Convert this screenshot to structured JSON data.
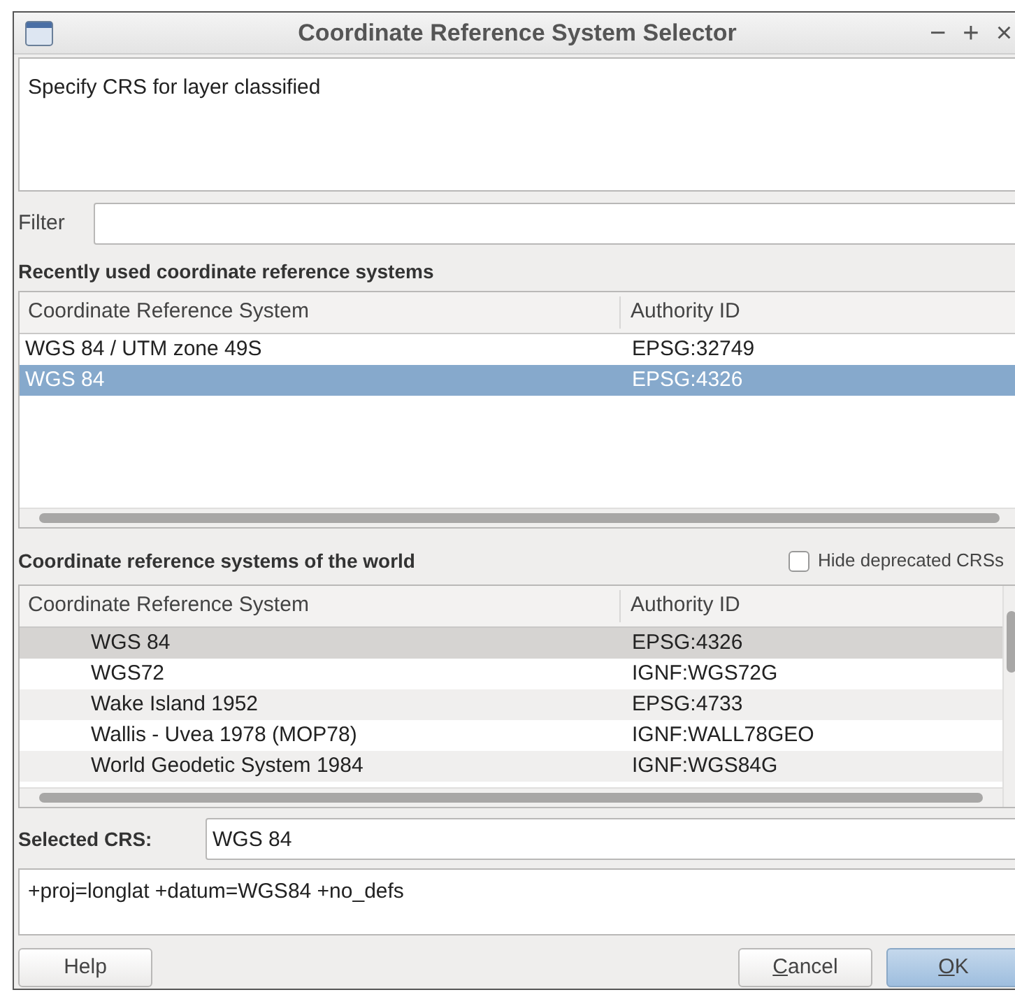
{
  "window": {
    "title": "Coordinate Reference System Selector",
    "controls": [
      "−",
      "+",
      "×"
    ]
  },
  "description": "Specify CRS for layer classified",
  "filter": {
    "label": "Filter"
  },
  "recent": {
    "heading": "Recently used coordinate reference systems",
    "columns": [
      "Coordinate Reference System",
      "Authority ID"
    ],
    "rows": [
      {
        "name": "WGS 84 / UTM zone 49S",
        "authority_id": "EPSG:32749",
        "selected": false
      },
      {
        "name": "WGS 84",
        "authority_id": "EPSG:4326",
        "selected": true
      }
    ]
  },
  "world": {
    "heading": "Coordinate reference systems of the world",
    "hide_deprecated": {
      "label": "Hide deprecated CRSs",
      "checked": false
    },
    "columns": [
      "Coordinate Reference System",
      "Authority ID"
    ],
    "rows": [
      {
        "name": "WGS 84",
        "authority_id": "EPSG:4326",
        "selected": true
      },
      {
        "name": "WGS72",
        "authority_id": "IGNF:WGS72G",
        "selected": false
      },
      {
        "name": "Wake Island 1952",
        "authority_id": "EPSG:4733",
        "selected": false
      },
      {
        "name": "Wallis - Uvea 1978 (MOP78)",
        "authority_id": "IGNF:WALL78GEO",
        "selected": false
      },
      {
        "name": "World Geodetic System 1984",
        "authority_id": "IGNF:WGS84G",
        "selected": false
      }
    ]
  },
  "selected_crs": {
    "label": "Selected CRS:",
    "value": "WGS 84"
  },
  "proj_definition": "+proj=longlat +datum=WGS84 +no_defs",
  "buttons": [
    {
      "label": "Help",
      "kind": "plain",
      "mnemonic_underlined": false
    },
    {
      "label": "Cancel",
      "kind": "plain",
      "mnemonic_underlined": true
    },
    {
      "label": "OK",
      "kind": "default",
      "mnemonic_underlined": true
    }
  ]
}
